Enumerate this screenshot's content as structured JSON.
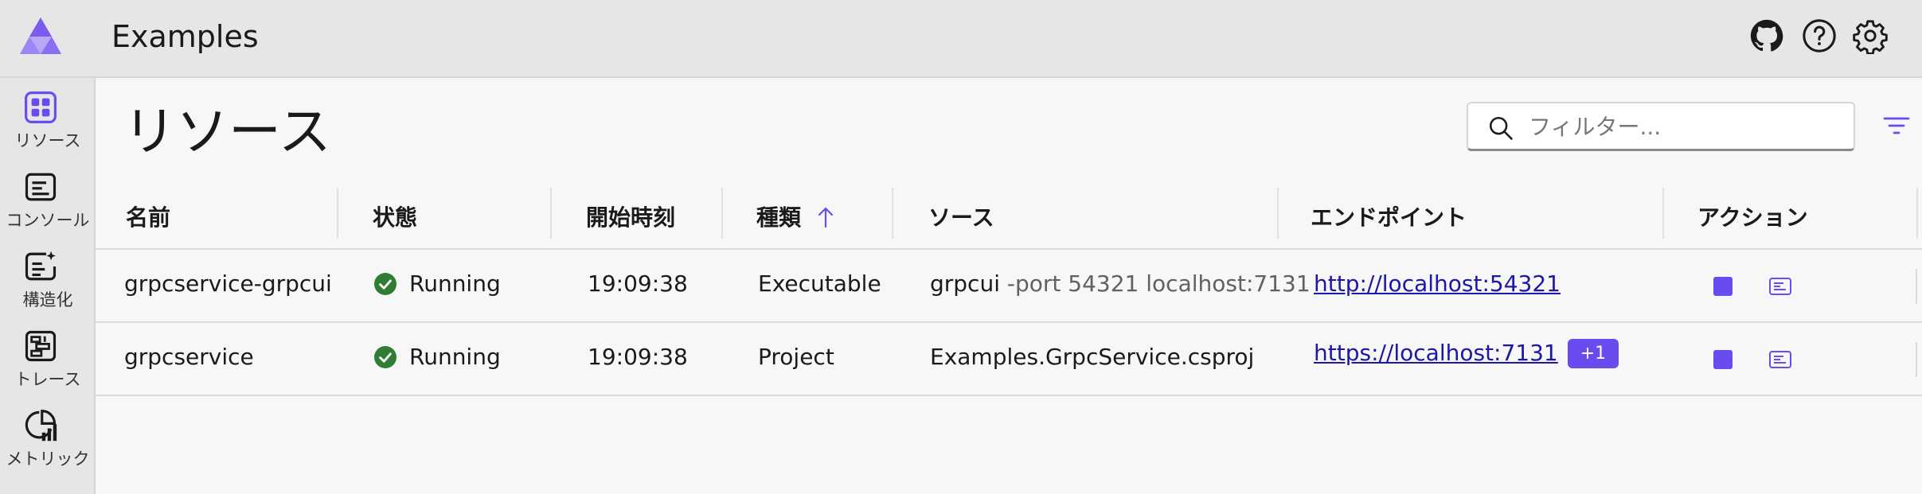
{
  "header": {
    "app_title": "Examples",
    "icons": [
      "github-icon",
      "help-icon",
      "settings-icon"
    ]
  },
  "sidebar": {
    "items": [
      {
        "label": "リソース",
        "icon": "resources-icon",
        "active": true
      },
      {
        "label": "コンソール",
        "icon": "console-icon",
        "active": false
      },
      {
        "label": "構造化",
        "icon": "structured-logs-icon",
        "active": false
      },
      {
        "label": "トレース",
        "icon": "traces-icon",
        "active": false
      },
      {
        "label": "メトリック",
        "icon": "metrics-icon",
        "active": false
      }
    ]
  },
  "main": {
    "title": "リソース",
    "filter": {
      "placeholder": "フィルター...",
      "value": ""
    }
  },
  "table": {
    "columns": [
      "名前",
      "状態",
      "開始時刻",
      "種類",
      "ソース",
      "エンドポイント",
      "アクション"
    ],
    "sort": {
      "column": "種類",
      "direction": "ascending"
    },
    "rows": [
      {
        "name": "grpcservice-grpcui",
        "state": "Running",
        "start_time": "19:09:38",
        "type": "Executable",
        "source": "grpcui",
        "source_args": "-port 54321 localhost:7131",
        "endpoint": "http://localhost:54321",
        "extra_endpoints": ""
      },
      {
        "name": "grpcservice",
        "state": "Running",
        "start_time": "19:09:38",
        "type": "Project",
        "source": "Examples.GrpcService.csproj",
        "source_args": "",
        "endpoint": "https://localhost:7131",
        "extra_endpoints": "+1"
      }
    ]
  },
  "colors": {
    "accent": "#6a4bef",
    "running": "#2e7d32",
    "link": "#1b17a8"
  }
}
